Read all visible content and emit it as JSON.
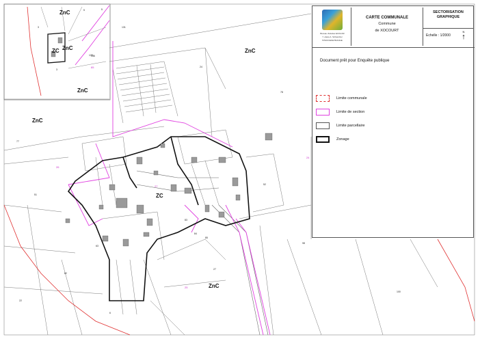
{
  "header": {
    "logo_text": [
      "Bureau d'études ECOLOR",
      "7, place A. Schweitzer",
      "57930 FENETRANGE"
    ],
    "title_line1": "CARTE COMMUNALE",
    "title_line2": "Commune",
    "title_line3": "de XOCOURT",
    "sectorisation_line1": "SECTORISATION",
    "sectorisation_line2": "GRAPHIQUE",
    "scale": "Echelle : 1/2000",
    "north": "N"
  },
  "notice": "Document prêt pour Enquête publique",
  "legend": [
    {
      "label": "Limite communale",
      "style": "dashed",
      "color": "#e03030"
    },
    {
      "label": "Limite de section",
      "style": "solid",
      "color": "#e040e0"
    },
    {
      "label": "Limite parcellaire",
      "style": "solid",
      "color": "#555555"
    },
    {
      "label": "Zonage",
      "style": "thick",
      "color": "#111111"
    }
  ],
  "zone_labels": {
    "inset_znc_top": "ZnC",
    "inset_zc": "ZC",
    "inset_znc_mid": "ZnC",
    "inset_znc_bottom": "ZnC",
    "main_znc_ne": "ZnC",
    "main_znc_w": "ZnC",
    "main_zc": "ZC",
    "main_znc_s": "ZnC"
  },
  "parcel_numbers": [
    "131",
    "100",
    "27",
    "22",
    "6",
    "5",
    "3",
    "77",
    "78",
    "24",
    "52",
    "98",
    "51",
    "82",
    "63",
    "83",
    "84",
    "85",
    "133",
    "3",
    "5",
    "136"
  ],
  "section_numbers": [
    "85",
    "24",
    "25",
    "26",
    "27"
  ],
  "colors": {
    "communal": "#e03030",
    "section": "#e040e0",
    "parcel": "#666666",
    "zonage": "#111111",
    "building": "#9a9a9a"
  }
}
